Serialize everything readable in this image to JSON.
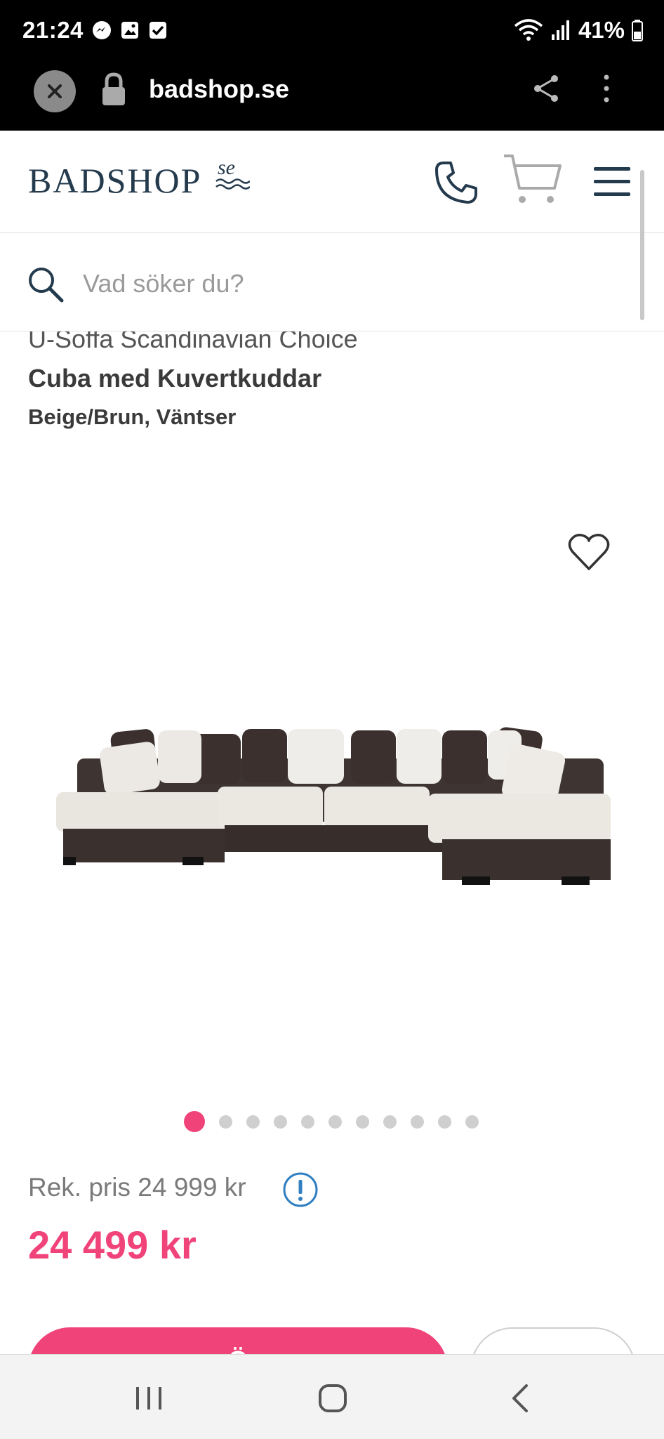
{
  "status_bar": {
    "time": "21:24",
    "battery": "41%",
    "icons": [
      "messenger-icon",
      "gallery-icon",
      "checkbox-icon",
      "wifi-icon",
      "signal-icon",
      "battery-icon"
    ]
  },
  "browser": {
    "url": "badshop.se",
    "icons": [
      "close-icon",
      "lock-icon",
      "share-icon",
      "more-vert-icon"
    ]
  },
  "header": {
    "logo_text": "BADSHOP",
    "logo_suffix": "se",
    "icons": [
      "phone-icon",
      "cart-icon",
      "menu-icon"
    ]
  },
  "search": {
    "placeholder": "Vad söker du?"
  },
  "product": {
    "brand": "U-Soffa Scandinavian Choice",
    "name": "Cuba med Kuvertkuddar",
    "variant": "Beige/Brun, Väntser",
    "image_count": 11,
    "active_image": 1
  },
  "pricing": {
    "recommended": "Rek. pris 24 999 kr",
    "price": "24 499 kr"
  },
  "actions": {
    "buy_label": "Ö"
  },
  "colors": {
    "accent": "#f0437a",
    "logo": "#243a4d",
    "info": "#2f7fc1"
  }
}
